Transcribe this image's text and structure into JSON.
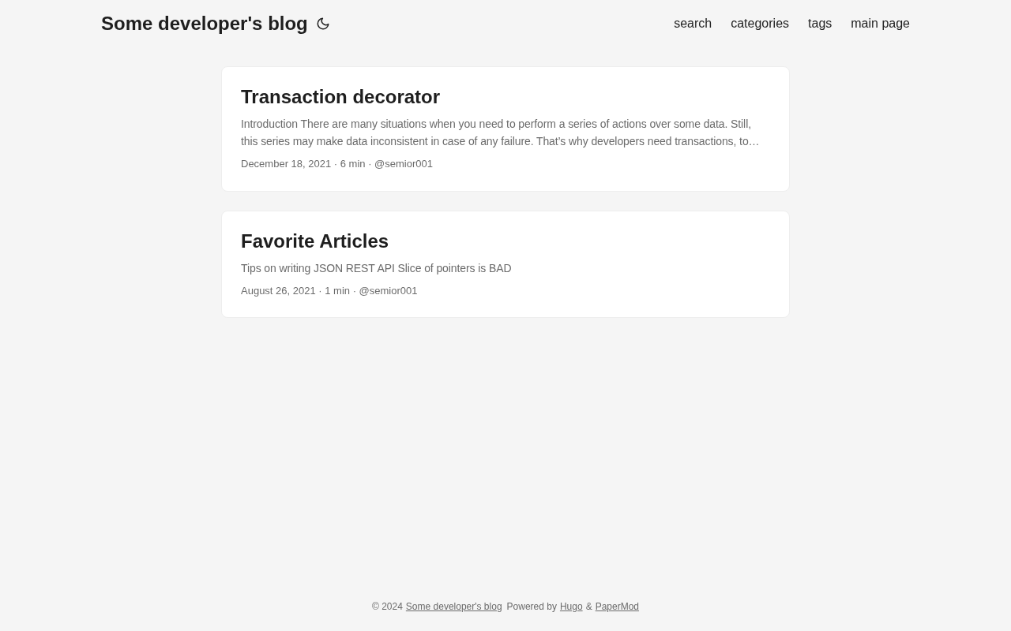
{
  "header": {
    "title": "Some developer's blog",
    "nav": [
      "search",
      "categories",
      "tags",
      "main page"
    ]
  },
  "posts": [
    {
      "title": "Transaction decorator",
      "summary": "Introduction There are many situations when you need to perform a series of actions over some data. Still, this series may make data inconsistent in case of any failure. That’s why developers need transactions, to…",
      "meta": "December 18, 2021 · 6 min · @semior001"
    },
    {
      "title": "Favorite Articles",
      "summary": "Tips on writing JSON REST API Slice of pointers is BAD",
      "meta": "August 26, 2021 · 1 min · @semior001"
    }
  ],
  "footer": {
    "copyright": "© 2024",
    "site_link": "Some developer's blog",
    "powered": "Powered by",
    "hugo_link": "Hugo",
    "amp": "&",
    "theme_link": "PaperMod"
  }
}
